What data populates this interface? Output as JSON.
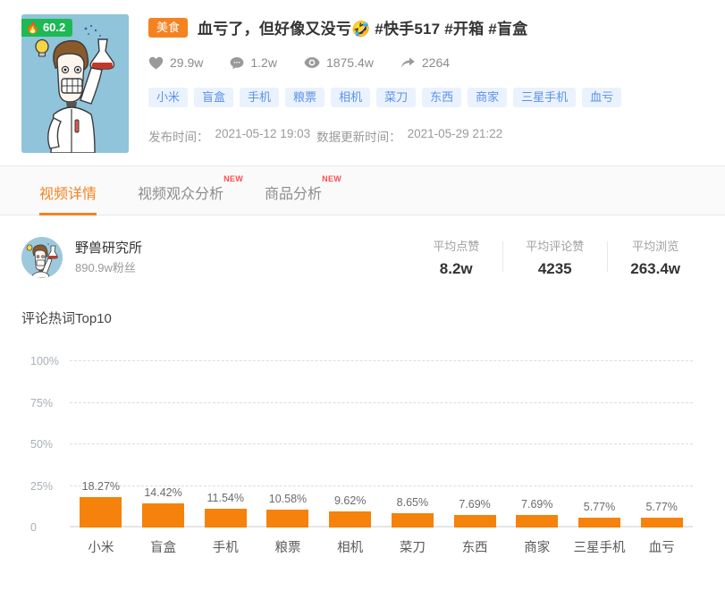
{
  "video": {
    "hot_score": "60.2",
    "hot_icon": "flame-icon",
    "category": "美食",
    "title": "血亏了，但好像又没亏🤣 #快手517 #开箱 #盲盒",
    "stats": [
      {
        "icon": "heart-icon",
        "value": "29.9w"
      },
      {
        "icon": "comment-icon",
        "value": "1.2w"
      },
      {
        "icon": "eye-icon",
        "value": "1875.4w"
      },
      {
        "icon": "share-icon",
        "value": "2264"
      }
    ],
    "keywords": [
      "小米",
      "盲盒",
      "手机",
      "粮票",
      "相机",
      "菜刀",
      "东西",
      "商家",
      "三星手机",
      "血亏"
    ],
    "publish_label": "发布时间：",
    "publish_time": "2021-05-12 19:03",
    "update_label": "数据更新时间：",
    "update_time": "2021-05-29 21:22"
  },
  "tabs": [
    {
      "label": "视频详情",
      "active": true,
      "badge": ""
    },
    {
      "label": "视频观众分析",
      "active": false,
      "badge": "NEW"
    },
    {
      "label": "商品分析",
      "active": false,
      "badge": "NEW"
    }
  ],
  "author": {
    "name": "野兽研究所",
    "fans": "890.9w粉丝"
  },
  "metrics": [
    {
      "label": "平均点赞",
      "value": "8.2w"
    },
    {
      "label": "平均评论赞",
      "value": "4235"
    },
    {
      "label": "平均浏览",
      "value": "263.4w"
    }
  ],
  "colors": {
    "accent": "#F58220",
    "bar": "#F5820A",
    "hot_badge": "#1DB954",
    "tag_bg": "#EAF2FE",
    "tag_text": "#5B92E8",
    "new_badge": "#ff4d4f"
  },
  "chart_data": {
    "type": "bar",
    "title": "评论热词Top10",
    "xlabel": "",
    "ylabel": "",
    "categories": [
      "小米",
      "盲盒",
      "手机",
      "粮票",
      "相机",
      "菜刀",
      "东西",
      "商家",
      "三星手机",
      "血亏"
    ],
    "values": [
      18.27,
      14.42,
      11.54,
      10.58,
      9.62,
      8.65,
      7.69,
      7.69,
      5.77,
      5.77
    ],
    "value_labels": [
      "18.27%",
      "14.42%",
      "11.54%",
      "10.58%",
      "9.62%",
      "8.65%",
      "7.69%",
      "7.69%",
      "5.77%",
      "5.77%"
    ],
    "ylim": [
      0,
      100
    ],
    "yticks": [
      0,
      25,
      50,
      75,
      100
    ],
    "ytick_labels": [
      "0",
      "25%",
      "50%",
      "75%",
      "100%"
    ],
    "grid": true,
    "legend": "none"
  }
}
